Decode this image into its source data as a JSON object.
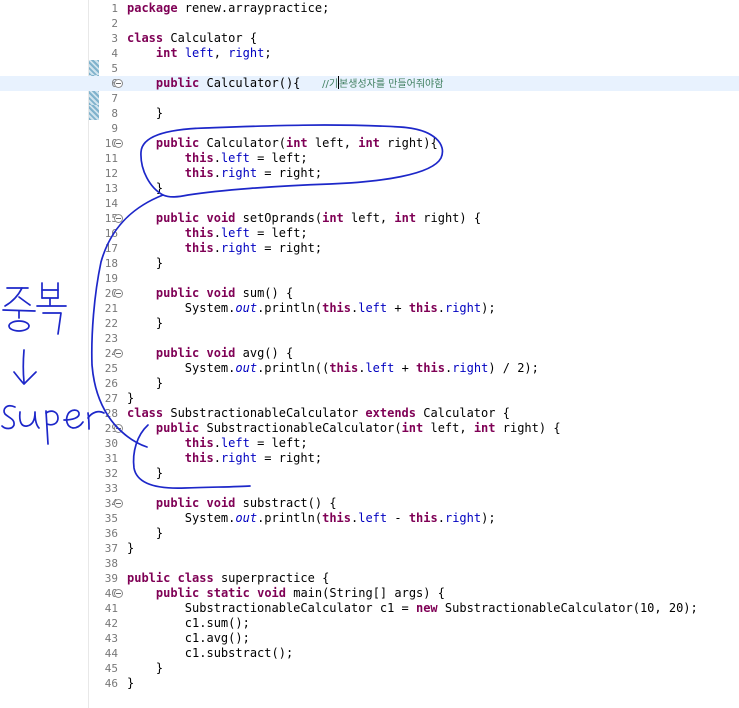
{
  "editor": {
    "lines": [
      {
        "n": "1",
        "fold": false,
        "segs": [
          [
            "kw",
            "package"
          ],
          [
            "t",
            " renew.arraypractice;"
          ]
        ]
      },
      {
        "n": "2",
        "fold": false,
        "segs": []
      },
      {
        "n": "3",
        "fold": false,
        "segs": [
          [
            "kw",
            "class"
          ],
          [
            "t",
            " Calculator {"
          ]
        ]
      },
      {
        "n": "4",
        "fold": false,
        "segs": [
          [
            "t",
            "    "
          ],
          [
            "kw",
            "int"
          ],
          [
            "t",
            " "
          ],
          [
            "fld",
            "left"
          ],
          [
            "t",
            ", "
          ],
          [
            "fld",
            "right"
          ],
          [
            "t",
            ";"
          ]
        ]
      },
      {
        "n": "5",
        "fold": false,
        "segs": []
      },
      {
        "n": "6",
        "fold": true,
        "current": true,
        "segs": [
          [
            "t",
            "    "
          ],
          [
            "kw",
            "public"
          ],
          [
            "t",
            " Calculator(){   "
          ],
          [
            "cm",
            "//기"
          ],
          [
            "caret",
            ""
          ],
          [
            "cm",
            "본생성자를 만들어줘야함"
          ]
        ]
      },
      {
        "n": "7",
        "fold": false,
        "segs": []
      },
      {
        "n": "8",
        "fold": false,
        "segs": [
          [
            "t",
            "    }"
          ]
        ]
      },
      {
        "n": "9",
        "fold": false,
        "segs": []
      },
      {
        "n": "10",
        "fold": true,
        "segs": [
          [
            "t",
            "    "
          ],
          [
            "kw",
            "public"
          ],
          [
            "t",
            " Calculator("
          ],
          [
            "kw",
            "int"
          ],
          [
            "t",
            " left, "
          ],
          [
            "kw",
            "int"
          ],
          [
            "t",
            " right){"
          ]
        ]
      },
      {
        "n": "11",
        "fold": false,
        "segs": [
          [
            "t",
            "        "
          ],
          [
            "kw",
            "this"
          ],
          [
            "t",
            "."
          ],
          [
            "fld",
            "left"
          ],
          [
            "t",
            " = left;"
          ]
        ]
      },
      {
        "n": "12",
        "fold": false,
        "segs": [
          [
            "t",
            "        "
          ],
          [
            "kw",
            "this"
          ],
          [
            "t",
            "."
          ],
          [
            "fld",
            "right"
          ],
          [
            "t",
            " = right;"
          ]
        ]
      },
      {
        "n": "13",
        "fold": false,
        "segs": [
          [
            "t",
            "    }"
          ]
        ]
      },
      {
        "n": "14",
        "fold": false,
        "segs": []
      },
      {
        "n": "15",
        "fold": true,
        "segs": [
          [
            "t",
            "    "
          ],
          [
            "kw",
            "public"
          ],
          [
            "t",
            " "
          ],
          [
            "kw",
            "void"
          ],
          [
            "t",
            " setOprands("
          ],
          [
            "kw",
            "int"
          ],
          [
            "t",
            " left, "
          ],
          [
            "kw",
            "int"
          ],
          [
            "t",
            " right) {"
          ]
        ]
      },
      {
        "n": "16",
        "fold": false,
        "segs": [
          [
            "t",
            "        "
          ],
          [
            "kw",
            "this"
          ],
          [
            "t",
            "."
          ],
          [
            "fld",
            "left"
          ],
          [
            "t",
            " = left;"
          ]
        ]
      },
      {
        "n": "17",
        "fold": false,
        "segs": [
          [
            "t",
            "        "
          ],
          [
            "kw",
            "this"
          ],
          [
            "t",
            "."
          ],
          [
            "fld",
            "right"
          ],
          [
            "t",
            " = right;"
          ]
        ]
      },
      {
        "n": "18",
        "fold": false,
        "segs": [
          [
            "t",
            "    }"
          ]
        ]
      },
      {
        "n": "19",
        "fold": false,
        "segs": []
      },
      {
        "n": "20",
        "fold": true,
        "segs": [
          [
            "t",
            "    "
          ],
          [
            "kw",
            "public"
          ],
          [
            "t",
            " "
          ],
          [
            "kw",
            "void"
          ],
          [
            "t",
            " sum() {"
          ]
        ]
      },
      {
        "n": "21",
        "fold": false,
        "segs": [
          [
            "t",
            "        System."
          ],
          [
            "st",
            "out"
          ],
          [
            "t",
            ".println("
          ],
          [
            "kw",
            "this"
          ],
          [
            "t",
            "."
          ],
          [
            "fld",
            "left"
          ],
          [
            "t",
            " + "
          ],
          [
            "kw",
            "this"
          ],
          [
            "t",
            "."
          ],
          [
            "fld",
            "right"
          ],
          [
            "t",
            ");"
          ]
        ]
      },
      {
        "n": "22",
        "fold": false,
        "segs": [
          [
            "t",
            "    }"
          ]
        ]
      },
      {
        "n": "23",
        "fold": false,
        "segs": []
      },
      {
        "n": "24",
        "fold": true,
        "segs": [
          [
            "t",
            "    "
          ],
          [
            "kw",
            "public"
          ],
          [
            "t",
            " "
          ],
          [
            "kw",
            "void"
          ],
          [
            "t",
            " avg() {"
          ]
        ]
      },
      {
        "n": "25",
        "fold": false,
        "segs": [
          [
            "t",
            "        System."
          ],
          [
            "st",
            "out"
          ],
          [
            "t",
            ".println(("
          ],
          [
            "kw",
            "this"
          ],
          [
            "t",
            "."
          ],
          [
            "fld",
            "left"
          ],
          [
            "t",
            " + "
          ],
          [
            "kw",
            "this"
          ],
          [
            "t",
            "."
          ],
          [
            "fld",
            "right"
          ],
          [
            "t",
            ") / 2);"
          ]
        ]
      },
      {
        "n": "26",
        "fold": false,
        "segs": [
          [
            "t",
            "    }"
          ]
        ]
      },
      {
        "n": "27",
        "fold": false,
        "segs": [
          [
            "t",
            "}"
          ]
        ]
      },
      {
        "n": "28",
        "fold": false,
        "segs": [
          [
            "kw",
            "class"
          ],
          [
            "t",
            " SubstractionableCalculator "
          ],
          [
            "kw",
            "extends"
          ],
          [
            "t",
            " Calculator {"
          ]
        ]
      },
      {
        "n": "29",
        "fold": true,
        "segs": [
          [
            "t",
            "    "
          ],
          [
            "kw",
            "public"
          ],
          [
            "t",
            " SubstractionableCalculator("
          ],
          [
            "kw",
            "int"
          ],
          [
            "t",
            " left, "
          ],
          [
            "kw",
            "int"
          ],
          [
            "t",
            " right) {"
          ]
        ]
      },
      {
        "n": "30",
        "fold": false,
        "segs": [
          [
            "t",
            "        "
          ],
          [
            "kw",
            "this"
          ],
          [
            "t",
            "."
          ],
          [
            "fld",
            "left"
          ],
          [
            "t",
            " = left;"
          ]
        ]
      },
      {
        "n": "31",
        "fold": false,
        "segs": [
          [
            "t",
            "        "
          ],
          [
            "kw",
            "this"
          ],
          [
            "t",
            "."
          ],
          [
            "fld",
            "right"
          ],
          [
            "t",
            " = right;"
          ]
        ]
      },
      {
        "n": "32",
        "fold": false,
        "segs": [
          [
            "t",
            "    }"
          ]
        ]
      },
      {
        "n": "33",
        "fold": false,
        "segs": []
      },
      {
        "n": "34",
        "fold": true,
        "segs": [
          [
            "t",
            "    "
          ],
          [
            "kw",
            "public"
          ],
          [
            "t",
            " "
          ],
          [
            "kw",
            "void"
          ],
          [
            "t",
            " substract() {"
          ]
        ]
      },
      {
        "n": "35",
        "fold": false,
        "segs": [
          [
            "t",
            "        System."
          ],
          [
            "st",
            "out"
          ],
          [
            "t",
            ".println("
          ],
          [
            "kw",
            "this"
          ],
          [
            "t",
            "."
          ],
          [
            "fld",
            "left"
          ],
          [
            "t",
            " - "
          ],
          [
            "kw",
            "this"
          ],
          [
            "t",
            "."
          ],
          [
            "fld",
            "right"
          ],
          [
            "t",
            ");"
          ]
        ]
      },
      {
        "n": "36",
        "fold": false,
        "segs": [
          [
            "t",
            "    }"
          ]
        ]
      },
      {
        "n": "37",
        "fold": false,
        "segs": [
          [
            "t",
            "}"
          ]
        ]
      },
      {
        "n": "38",
        "fold": false,
        "segs": []
      },
      {
        "n": "39",
        "fold": false,
        "segs": [
          [
            "kw",
            "public"
          ],
          [
            "t",
            " "
          ],
          [
            "kw",
            "class"
          ],
          [
            "t",
            " superpractice {"
          ]
        ]
      },
      {
        "n": "40",
        "fold": true,
        "segs": [
          [
            "t",
            "    "
          ],
          [
            "kw",
            "public"
          ],
          [
            "t",
            " "
          ],
          [
            "kw",
            "static"
          ],
          [
            "t",
            " "
          ],
          [
            "kw",
            "void"
          ],
          [
            "t",
            " main(String[] args) {"
          ]
        ]
      },
      {
        "n": "41",
        "fold": false,
        "segs": [
          [
            "t",
            "        SubstractionableCalculator c1 = "
          ],
          [
            "kw",
            "new"
          ],
          [
            "t",
            " SubstractionableCalculator(10, 20);"
          ]
        ]
      },
      {
        "n": "42",
        "fold": false,
        "segs": [
          [
            "t",
            "        c1.sum();"
          ]
        ]
      },
      {
        "n": "43",
        "fold": false,
        "segs": [
          [
            "t",
            "        c1.avg();"
          ]
        ]
      },
      {
        "n": "44",
        "fold": false,
        "segs": [
          [
            "t",
            "        c1.substract();"
          ]
        ]
      },
      {
        "n": "45",
        "fold": false,
        "segs": [
          [
            "t",
            "    }"
          ]
        ]
      },
      {
        "n": "46",
        "fold": false,
        "segs": [
          [
            "t",
            "}"
          ]
        ]
      }
    ]
  },
  "annotation": {
    "color": "#1d27c9",
    "words": [
      "중복",
      "super"
    ]
  }
}
